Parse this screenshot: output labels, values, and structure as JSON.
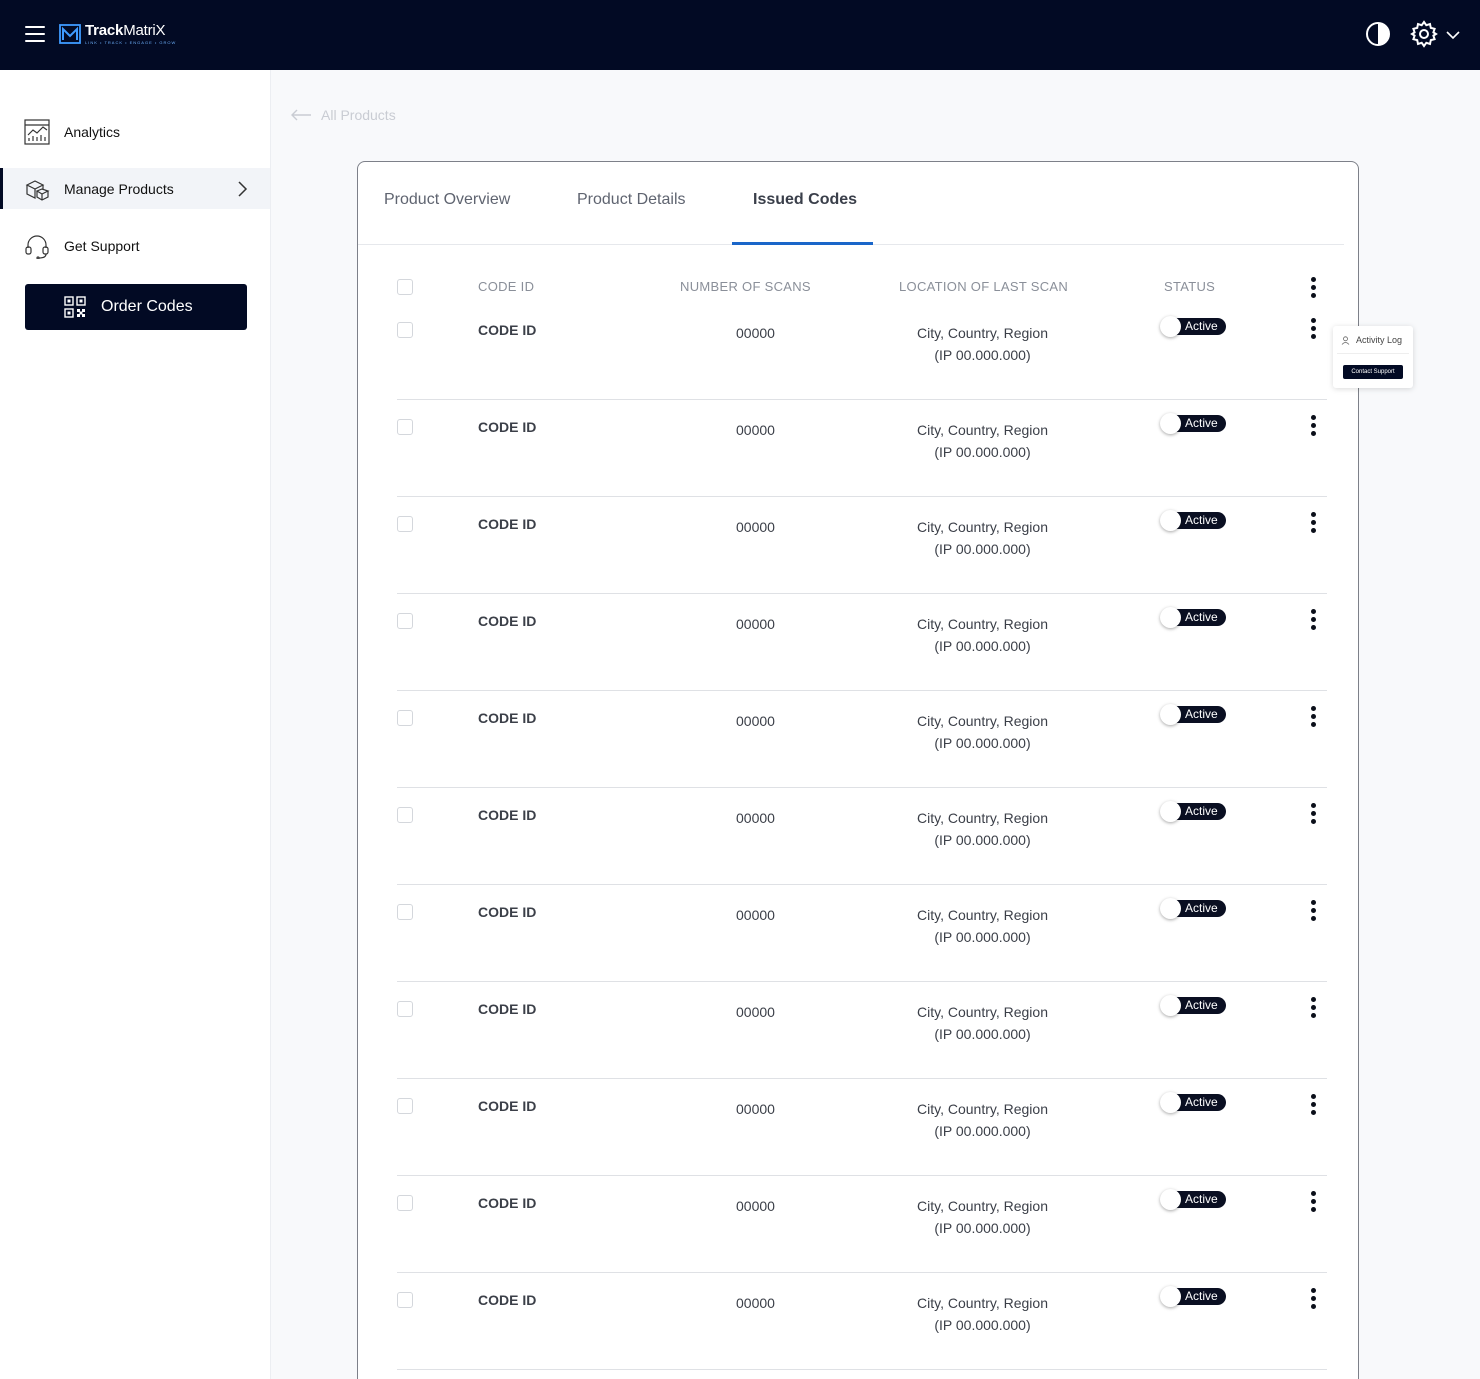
{
  "header": {
    "logo_bold": "Track",
    "logo_regular": "MatriX",
    "logo_tagline": "LINK • TRACK • ENGAGE • GROW",
    "icons": [
      "menu-icon",
      "contrast-icon",
      "gear-icon",
      "chevron-down-icon"
    ]
  },
  "sidebar": {
    "items": [
      {
        "label": "Analytics",
        "icon": "analytics-icon"
      },
      {
        "label": "Manage Products",
        "icon": "boxes-icon"
      },
      {
        "label": "Get Support",
        "icon": "headset-icon"
      }
    ],
    "order_button": "Order Codes"
  },
  "breadcrumb": {
    "label": "All Products"
  },
  "tabs": [
    {
      "label": "Product Overview"
    },
    {
      "label": "Product Details"
    },
    {
      "label": "Issued Codes"
    }
  ],
  "table": {
    "headers": {
      "code_id": "CODE ID",
      "scans": "NUMBER OF SCANS",
      "location": "LOCATION OF LAST SCAN",
      "status": "STATUS"
    },
    "rows": [
      {
        "code": "CODE ID",
        "scans": "00000",
        "loc1": "City, Country, Region",
        "loc2": "(IP 00.000.000)",
        "status": "Active"
      },
      {
        "code": "CODE ID",
        "scans": "00000",
        "loc1": "City, Country, Region",
        "loc2": "(IP 00.000.000)",
        "status": "Active"
      },
      {
        "code": "CODE ID",
        "scans": "00000",
        "loc1": "City, Country, Region",
        "loc2": "(IP 00.000.000)",
        "status": "Active"
      },
      {
        "code": "CODE ID",
        "scans": "00000",
        "loc1": "City, Country, Region",
        "loc2": "(IP 00.000.000)",
        "status": "Active"
      },
      {
        "code": "CODE ID",
        "scans": "00000",
        "loc1": "City, Country, Region",
        "loc2": "(IP 00.000.000)",
        "status": "Active"
      },
      {
        "code": "CODE ID",
        "scans": "00000",
        "loc1": "City, Country, Region",
        "loc2": "(IP 00.000.000)",
        "status": "Active"
      },
      {
        "code": "CODE ID",
        "scans": "00000",
        "loc1": "City, Country, Region",
        "loc2": "(IP 00.000.000)",
        "status": "Active"
      },
      {
        "code": "CODE ID",
        "scans": "00000",
        "loc1": "City, Country, Region",
        "loc2": "(IP 00.000.000)",
        "status": "Active"
      },
      {
        "code": "CODE ID",
        "scans": "00000",
        "loc1": "City, Country, Region",
        "loc2": "(IP 00.000.000)",
        "status": "Active"
      },
      {
        "code": "CODE ID",
        "scans": "00000",
        "loc1": "City, Country, Region",
        "loc2": "(IP 00.000.000)",
        "status": "Active"
      },
      {
        "code": "CODE ID",
        "scans": "00000",
        "loc1": "City, Country, Region",
        "loc2": "(IP 00.000.000)",
        "status": "Active"
      }
    ]
  },
  "popup": {
    "activity_log": "Activity Log",
    "contact_support": "Contact Support"
  },
  "colors": {
    "navy": "#020a24",
    "tab_indicator": "#1a66c9",
    "pill": "#0a0f22"
  }
}
